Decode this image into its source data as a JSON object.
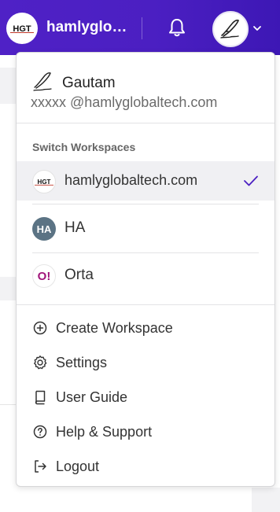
{
  "header": {
    "workspace_name": "hamlyglobaltech.com",
    "workspace_logo_text": "HGT",
    "brand_color": "#4b1fc2"
  },
  "profile": {
    "name": "Gautam",
    "email": "xxxxx @hamlyglobaltech.com"
  },
  "switcher": {
    "section_title": "Switch Workspaces",
    "workspaces": [
      {
        "label": "hamlyglobaltech.com",
        "icon_text": "HGT",
        "selected": true
      },
      {
        "label": "HA",
        "icon_text": "HA",
        "icon_color": "#5b7384",
        "selected": false
      },
      {
        "label": "Orta",
        "icon_text": "O!",
        "icon_color": "#a0157a",
        "selected": false
      }
    ]
  },
  "menu": {
    "items": [
      {
        "label": "Create Workspace",
        "icon": "plus-circle-icon"
      },
      {
        "label": "Settings",
        "icon": "gear-icon"
      },
      {
        "label": "User Guide",
        "icon": "book-icon"
      },
      {
        "label": "Help & Support",
        "icon": "question-circle-icon"
      },
      {
        "label": "Logout",
        "icon": "logout-icon"
      }
    ]
  }
}
